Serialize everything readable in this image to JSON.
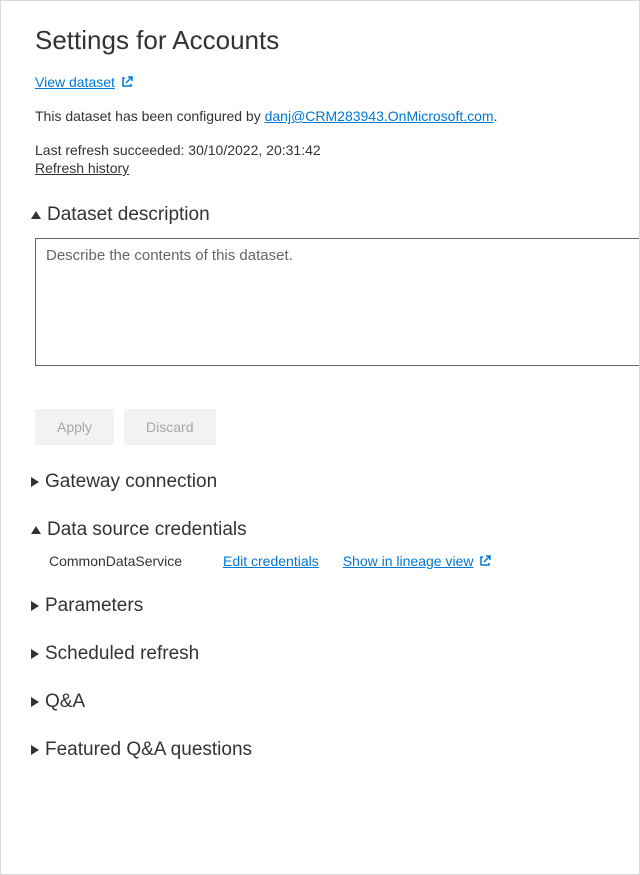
{
  "title": "Settings for Accounts",
  "view_dataset_label": "View dataset",
  "configured_prefix": "This dataset has been configured by ",
  "configured_email": "danj@CRM283943.OnMicrosoft.com",
  "configured_suffix": ".",
  "last_refresh": "Last refresh succeeded: 30/10/2022, 20:31:42",
  "refresh_history_label": "Refresh history",
  "sections": {
    "dataset_description": {
      "label": "Dataset description",
      "expanded": true
    },
    "gateway_connection": {
      "label": "Gateway connection",
      "expanded": false
    },
    "data_source_credentials": {
      "label": "Data source credentials",
      "expanded": true
    },
    "parameters": {
      "label": "Parameters",
      "expanded": false
    },
    "scheduled_refresh": {
      "label": "Scheduled refresh",
      "expanded": false
    },
    "qa": {
      "label": "Q&A",
      "expanded": false
    },
    "featured_qa": {
      "label": "Featured Q&A questions",
      "expanded": false
    }
  },
  "description": {
    "placeholder": "Describe the contents of this dataset.",
    "value": "",
    "apply_label": "Apply",
    "discard_label": "Discard"
  },
  "credentials": {
    "source_name": "CommonDataService",
    "edit_label": "Edit credentials",
    "lineage_label": "Show in lineage view"
  }
}
